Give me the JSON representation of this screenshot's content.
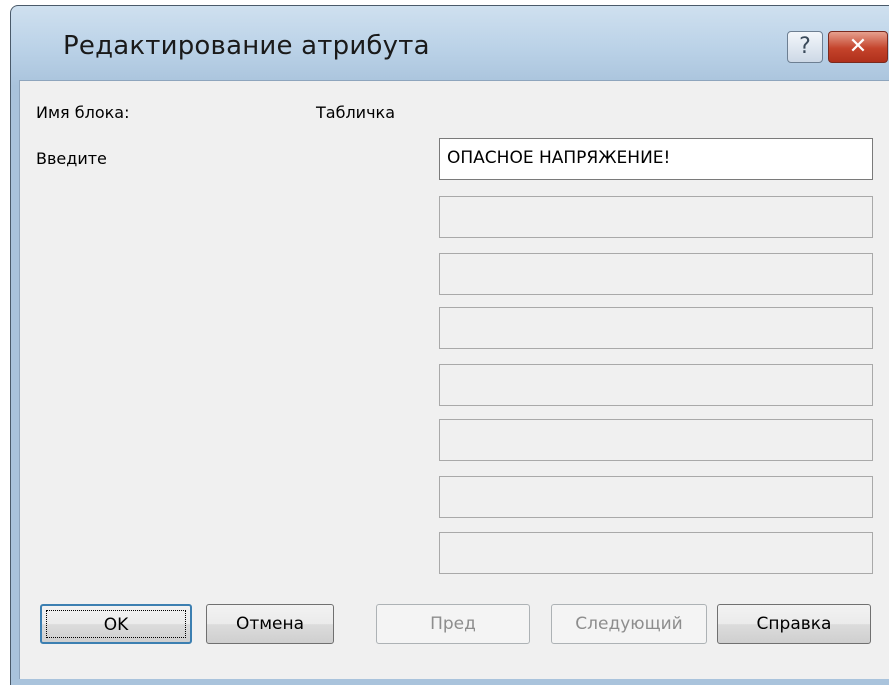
{
  "window": {
    "title": "Редактирование атрибута",
    "help_button": "?",
    "close_button": "✕"
  },
  "form": {
    "block_name_label": "Имя блока:",
    "block_name_value": "Табличка",
    "enter_label": "Введите",
    "attribute_value": "ОПАСНОЕ НАПРЯЖЕНИЕ!"
  },
  "buttons": {
    "ok": "OK",
    "cancel": "Отмена",
    "prev": "Пред",
    "next": "Следующий",
    "help": "Справка"
  },
  "colors": {
    "title_gradient": "#bcd3e8",
    "client_bg": "#f0f0f0",
    "close_red": "#c4432b"
  }
}
